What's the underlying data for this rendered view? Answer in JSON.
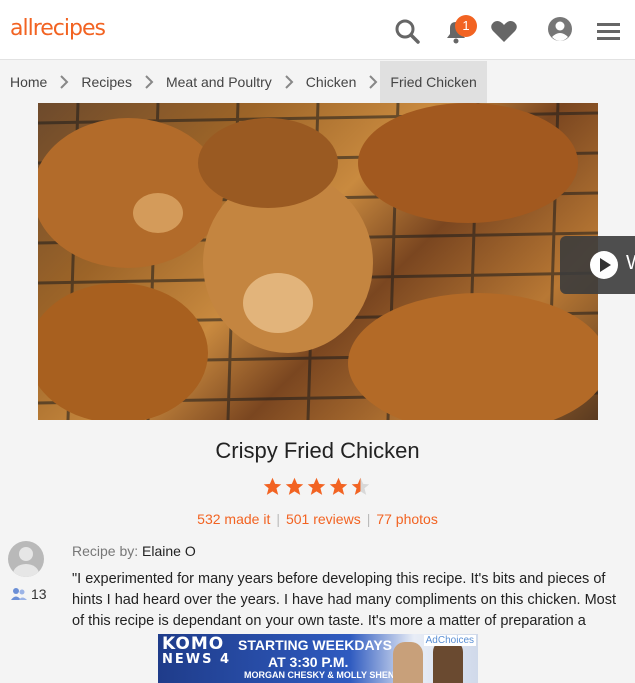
{
  "header": {
    "logo": "allrecipes",
    "notification_count": "1",
    "brand_color": "#f26322",
    "icons": [
      "search-icon",
      "bell-icon",
      "heart-icon",
      "profile-icon",
      "menu-icon"
    ]
  },
  "breadcrumb": [
    "Home",
    "Recipes",
    "Meat and Poultry",
    "Chicken",
    "Fried Chicken"
  ],
  "video": {
    "label": "W"
  },
  "recipe": {
    "title": "Crispy Fried Chicken",
    "rating": 4.5,
    "made_it": "532 made it",
    "reviews": "501 reviews",
    "photos": "77 photos"
  },
  "author": {
    "label": "Recipe by:",
    "name": "Elaine O",
    "followers": "13"
  },
  "description": "\"I experimented for many years before developing this recipe. It's bits and pieces of hints I had heard over the years. I have had many compliments on this chicken. Most of this recipe is dependant on your own taste. It's more a matter of preparation a",
  "ad": {
    "brand_top": "KOMO",
    "brand_bottom": "NEWS 4",
    "line1": "STARTING WEEKDAYS",
    "line2": "AT 3:30 P.M.",
    "line3": "MORGAN CHESKY & MOLLY SHEN",
    "adchoices": "AdChoices"
  }
}
